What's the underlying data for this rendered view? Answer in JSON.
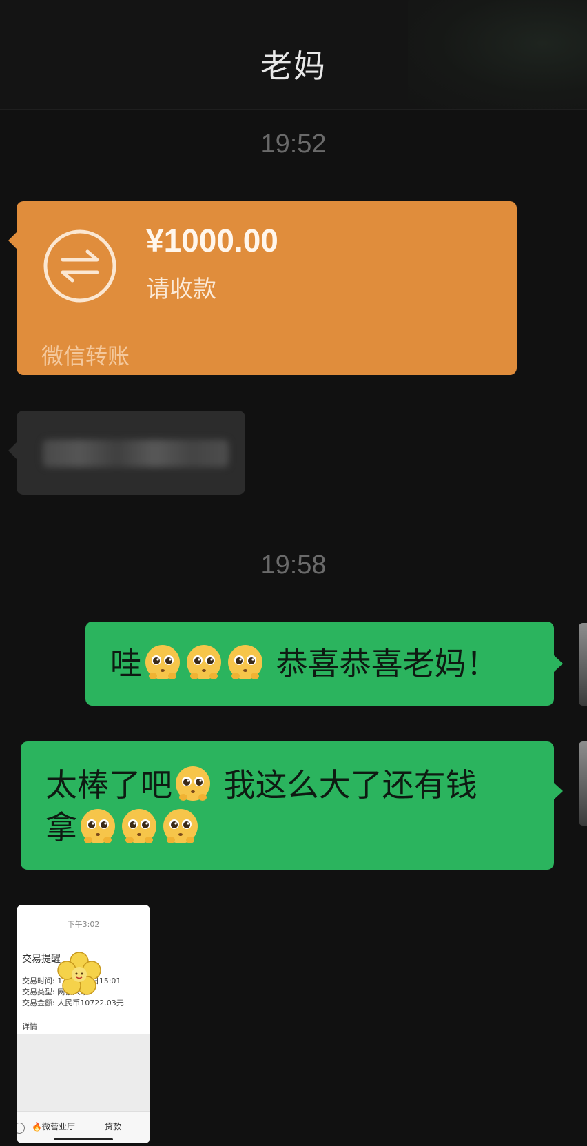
{
  "header": {
    "title": "老妈"
  },
  "messages": {
    "timestamp1": "19:52",
    "timestamp2": "19:58",
    "transfer": {
      "amount": "¥1000.00",
      "status": "请收款",
      "brand": "微信转账"
    },
    "bubble1": {
      "text_before": "哇",
      "text_after": " 恭喜恭喜老妈！"
    },
    "bubble2": {
      "line1_before": "太棒了吧",
      "line1_after": " 我这么大了还有钱",
      "line2": "拿"
    },
    "screenshot": {
      "status_time": "下午3:02",
      "title": "交易提醒",
      "row1": "交易时间: 1        12月15日15:01",
      "row2": "交易类型: 网银入账",
      "row3": "交易金额: 人民币10722.03元",
      "detail": "详情",
      "bottom_item1": "🔥微营业厅",
      "bottom_item2": "贷款"
    }
  },
  "colors": {
    "background": "#111111",
    "transfer_card": "#e08d3c",
    "outgoing_bubble": "#2bb45e",
    "incoming_bubble": "#2c2c2c"
  },
  "icons": [
    "transfer-arrows-icon",
    "pleading-face-emoji",
    "flower-sticker"
  ]
}
